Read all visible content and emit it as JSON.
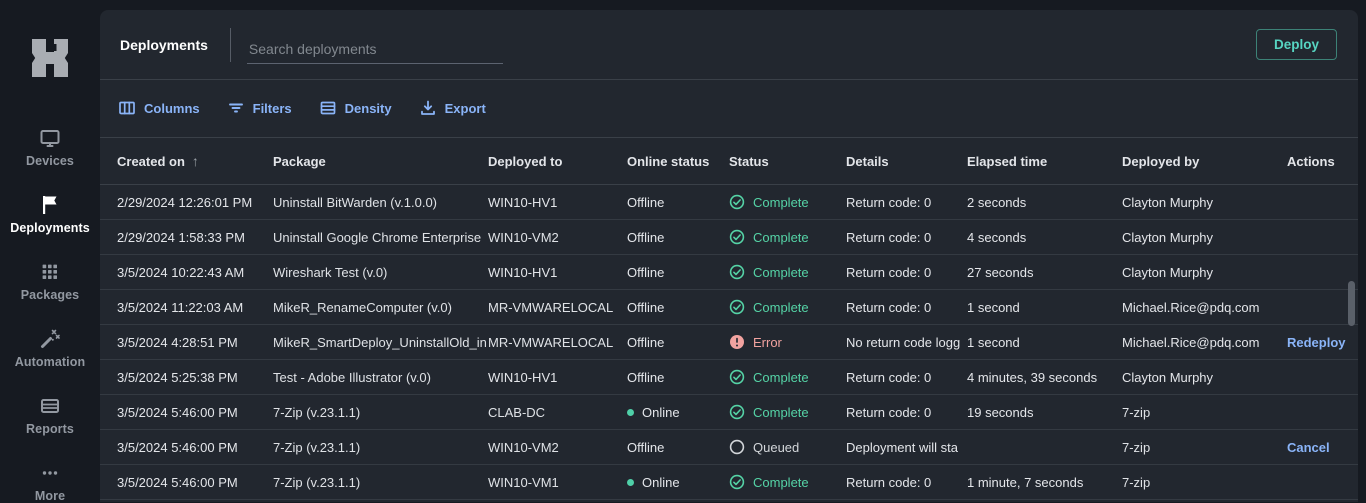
{
  "header": {
    "title": "Deployments",
    "search_placeholder": "Search deployments",
    "deploy_label": "Deploy"
  },
  "sidebar": {
    "items": [
      {
        "id": "devices",
        "label": "Devices",
        "active": false
      },
      {
        "id": "deployments",
        "label": "Deployments",
        "active": true
      },
      {
        "id": "packages",
        "label": "Packages",
        "active": false
      },
      {
        "id": "automation",
        "label": "Automation",
        "active": false
      },
      {
        "id": "reports",
        "label": "Reports",
        "active": false
      },
      {
        "id": "more",
        "label": "More",
        "active": false
      }
    ]
  },
  "toolbar": {
    "buttons": [
      {
        "id": "columns",
        "label": "Columns"
      },
      {
        "id": "filters",
        "label": "Filters"
      },
      {
        "id": "density",
        "label": "Density"
      },
      {
        "id": "export",
        "label": "Export"
      }
    ]
  },
  "table": {
    "columns": [
      "Created on",
      "Package",
      "Deployed to",
      "Online status",
      "Status",
      "Details",
      "Elapsed time",
      "Deployed by",
      "Actions"
    ],
    "sort": {
      "column": "Created on",
      "direction": "asc"
    },
    "rows": [
      {
        "created_on": "2/29/2024 12:26:01 PM",
        "package": "Uninstall BitWarden (v.1.0.0)",
        "deployed_to": "WIN10-HV1",
        "deployed_to_link": false,
        "online_status": "Offline",
        "status": "Complete",
        "details": "Return code: 0",
        "elapsed_time": "2 seconds",
        "deployed_by": "Clayton Murphy",
        "deployed_by_link": false,
        "action": ""
      },
      {
        "created_on": "2/29/2024 1:58:33 PM",
        "package": "Uninstall Google Chrome Enterprise",
        "deployed_to": "WIN10-VM2",
        "deployed_to_link": true,
        "online_status": "Offline",
        "status": "Complete",
        "details": "Return code: 0",
        "elapsed_time": "4 seconds",
        "deployed_by": "Clayton Murphy",
        "deployed_by_link": false,
        "action": ""
      },
      {
        "created_on": "3/5/2024 10:22:43 AM",
        "package": "Wireshark Test (v.0)",
        "deployed_to": "WIN10-HV1",
        "deployed_to_link": false,
        "online_status": "Offline",
        "status": "Complete",
        "details": "Return code: 0",
        "elapsed_time": "27 seconds",
        "deployed_by": "Clayton Murphy",
        "deployed_by_link": false,
        "action": ""
      },
      {
        "created_on": "3/5/2024 11:22:03 AM",
        "package": "MikeR_RenameComputer (v.0)",
        "deployed_to": "MR-VMWARELOCAL",
        "deployed_to_link": true,
        "online_status": "Offline",
        "status": "Complete",
        "details": "Return code: 0",
        "elapsed_time": "1 second",
        "deployed_by": "Michael.Rice@pdq.com",
        "deployed_by_link": false,
        "action": ""
      },
      {
        "created_on": "3/5/2024 4:28:51 PM",
        "package": "MikeR_SmartDeploy_UninstallOld_in",
        "deployed_to": "MR-VMWARELOCAL",
        "deployed_to_link": true,
        "online_status": "Offline",
        "status": "Error",
        "details": "No return code logg",
        "elapsed_time": "1 second",
        "deployed_by": "Michael.Rice@pdq.com",
        "deployed_by_link": false,
        "action": "Redeploy"
      },
      {
        "created_on": "3/5/2024 5:25:38 PM",
        "package": "Test - Adobe Illustrator (v.0)",
        "deployed_to": "WIN10-HV1",
        "deployed_to_link": false,
        "online_status": "Offline",
        "status": "Complete",
        "details": "Return code: 0",
        "elapsed_time": "4 minutes, 39 seconds",
        "deployed_by": "Clayton Murphy",
        "deployed_by_link": false,
        "action": ""
      },
      {
        "created_on": "3/5/2024 5:46:00 PM",
        "package": "7-Zip (v.23.1.1)",
        "deployed_to": "CLAB-DC",
        "deployed_to_link": true,
        "online_status": "Online",
        "status": "Complete",
        "details": "Return code: 0",
        "elapsed_time": "19 seconds",
        "deployed_by": "7-zip",
        "deployed_by_link": true,
        "action": ""
      },
      {
        "created_on": "3/5/2024 5:46:00 PM",
        "package": "7-Zip (v.23.1.1)",
        "deployed_to": "WIN10-VM2",
        "deployed_to_link": true,
        "online_status": "Offline",
        "status": "Queued",
        "details": "Deployment will sta",
        "elapsed_time": "",
        "deployed_by": "7-zip",
        "deployed_by_link": true,
        "action": "Cancel"
      },
      {
        "created_on": "3/5/2024 5:46:00 PM",
        "package": "7-Zip (v.23.1.1)",
        "deployed_to": "WIN10-VM1",
        "deployed_to_link": true,
        "online_status": "Online",
        "status": "Complete",
        "details": "Return code: 0",
        "elapsed_time": "1 minute, 7 seconds",
        "deployed_by": "7-zip",
        "deployed_by_link": true,
        "action": ""
      }
    ]
  },
  "colors": {
    "accent_blue": "#8ab4f8",
    "success_teal": "#55d3a6",
    "error_pink": "#f2a3a0",
    "queued_gray": "#d3d6da",
    "deploy_teal": "#57d5c2",
    "online_dot": "#4fd0a8"
  }
}
